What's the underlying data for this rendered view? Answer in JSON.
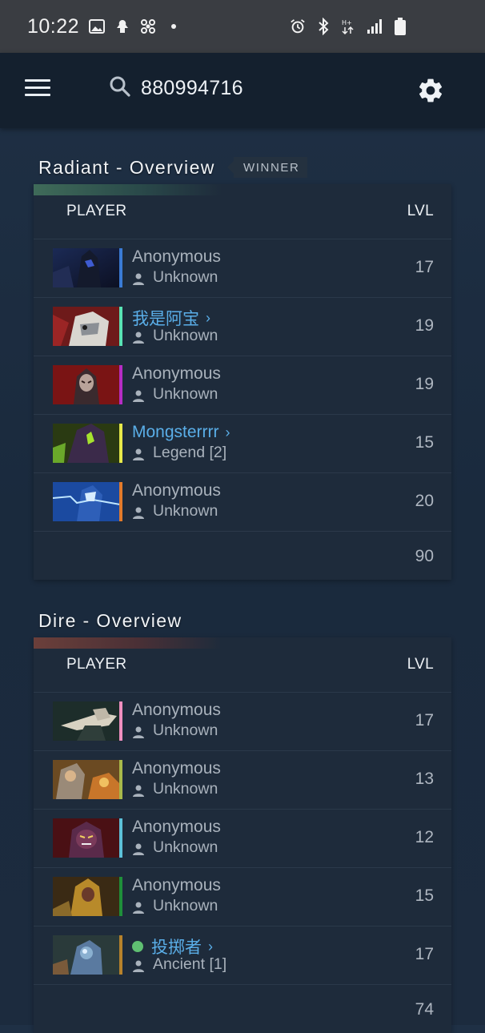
{
  "status_bar": {
    "time": "10:22"
  },
  "search": {
    "query": "880994716"
  },
  "colors": {
    "link": "#5aaee8",
    "radiant_accent": "#3f6b59",
    "dire_accent": "#6b3f3a"
  },
  "radiant": {
    "title": "Radiant - Overview",
    "badge": "WINNER",
    "header_player": "PLAYER",
    "header_lvl": "LVL",
    "players": [
      {
        "name": "Anonymous",
        "rank": "Unknown",
        "level": "17",
        "stripe": "#3a7bd5",
        "link": false
      },
      {
        "name": "我是阿宝",
        "rank": "Unknown",
        "level": "19",
        "stripe": "#59e3b4",
        "link": true
      },
      {
        "name": "Anonymous",
        "rank": "Unknown",
        "level": "19",
        "stripe": "#b62cc4",
        "link": false
      },
      {
        "name": "Mongsterrrr",
        "rank": "Legend [2]",
        "level": "15",
        "stripe": "#e6e84a",
        "link": true
      },
      {
        "name": "Anonymous",
        "rank": "Unknown",
        "level": "20",
        "stripe": "#e27a2b",
        "link": false
      }
    ],
    "total_level": "90"
  },
  "dire": {
    "title": "Dire - Overview",
    "header_player": "PLAYER",
    "header_lvl": "LVL",
    "players": [
      {
        "name": "Anonymous",
        "rank": "Unknown",
        "level": "17",
        "stripe": "#f08fbf",
        "link": false
      },
      {
        "name": "Anonymous",
        "rank": "Unknown",
        "level": "13",
        "stripe": "#a8b94a",
        "link": false
      },
      {
        "name": "Anonymous",
        "rank": "Unknown",
        "level": "12",
        "stripe": "#5cc1d9",
        "link": false
      },
      {
        "name": "Anonymous",
        "rank": "Unknown",
        "level": "15",
        "stripe": "#1f8f3a",
        "link": false
      },
      {
        "name": "投掷者",
        "rank": "Ancient [1]",
        "level": "17",
        "stripe": "#b7822b",
        "link": true,
        "online": true
      }
    ],
    "total_level": "74"
  }
}
